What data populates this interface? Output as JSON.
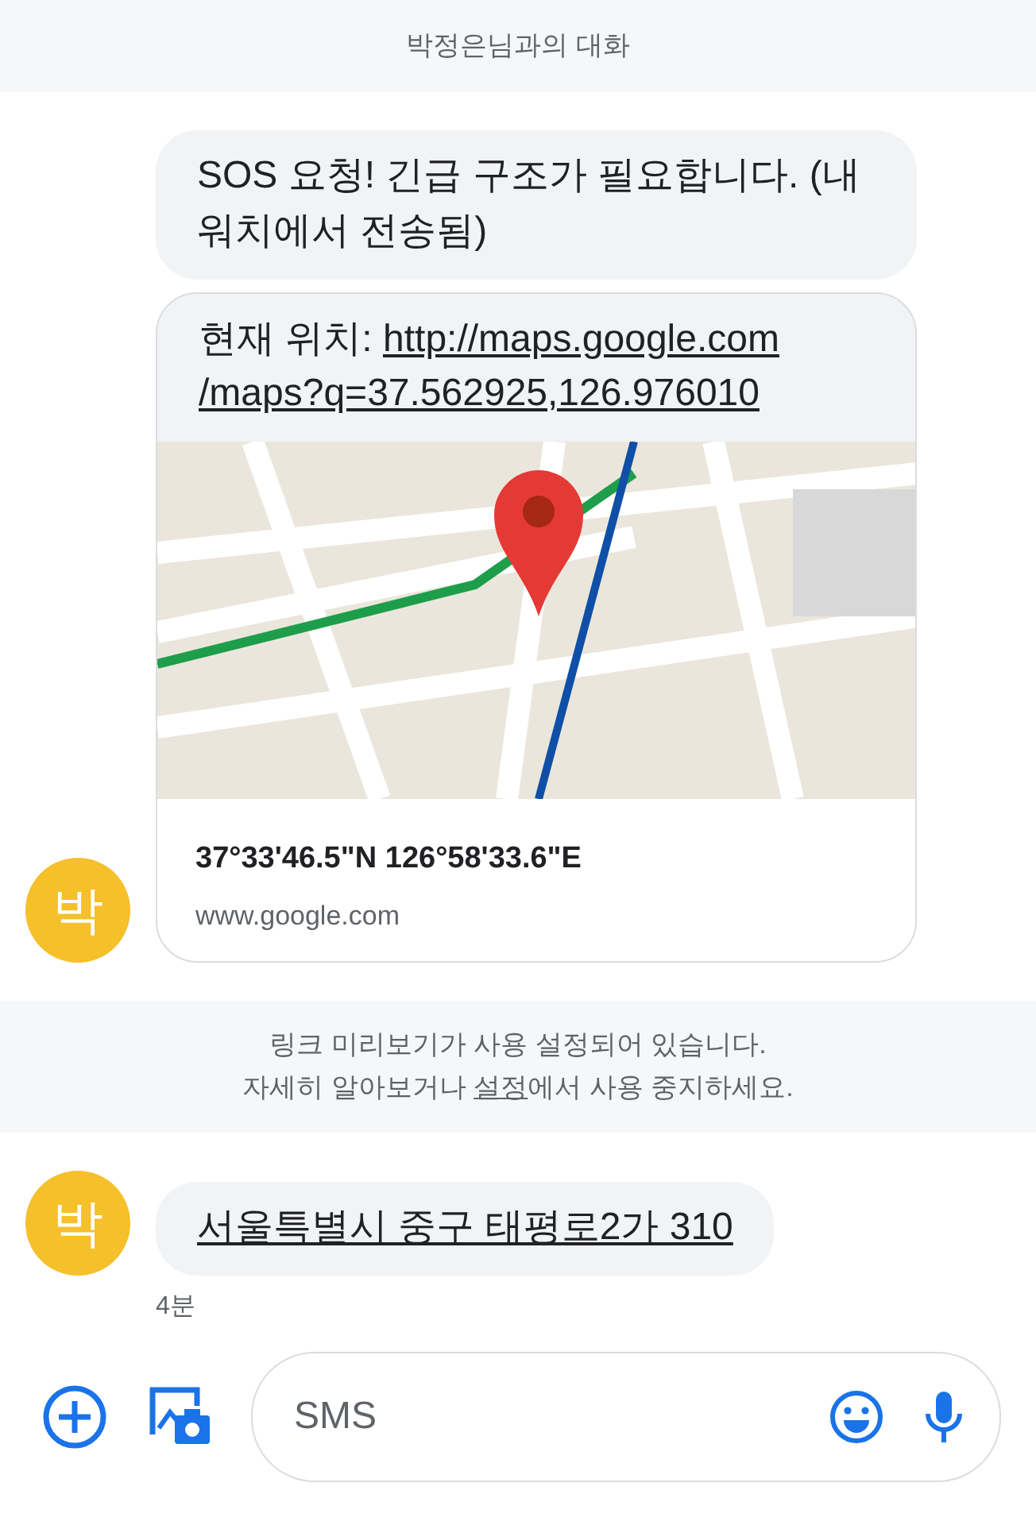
{
  "header": {
    "title": "박정은님과의 대화"
  },
  "messages": [
    {
      "kind": "text",
      "text": "SOS 요청! 긴급 구조가 필요합니다. (내 워치에서 전송됨)"
    },
    {
      "kind": "link_preview",
      "sender_initial": "박",
      "prefix": "현재 위치: ",
      "link_lines": [
        "http://maps.google.com",
        "/maps?q=37.562925,126.976010"
      ],
      "preview": {
        "kind": "picture",
        "title": "37°33'46.5\"N 126°58'33.6\"E",
        "domain": "www.google.com"
      }
    }
  ],
  "notice": {
    "line_1": "링크 미리보기가 사용 설정되어 있습니다.",
    "before": "자세히 알아보거나 ",
    "link": "설정",
    "after": "에서 사용 중지하세요."
  },
  "messages_2": [
    {
      "kind": "link",
      "sender_initial": "박",
      "text": "서울특별시 중구 태평로2가 310",
      "time": "4분"
    }
  ],
  "composer": {
    "placeholder": "SMS"
  }
}
